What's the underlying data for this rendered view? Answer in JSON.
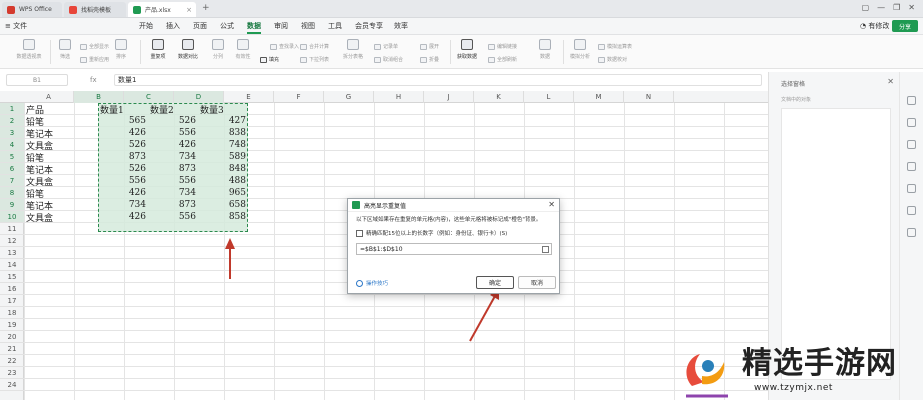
{
  "titlebar": {
    "tabs": [
      {
        "label": "WPS Office",
        "icon": "wps-logo-icon"
      },
      {
        "label": "找稻壳模板",
        "icon": "docer-icon"
      },
      {
        "label": "产品.xlsx",
        "icon": "spreadsheet-icon"
      }
    ],
    "new_tab": "+"
  },
  "menubar": {
    "file_label": "文件",
    "items": [
      "开始",
      "插入",
      "页面",
      "公式",
      "数据",
      "审阅",
      "视图",
      "工具",
      "会员专享",
      "效率"
    ],
    "active": "数据",
    "comment_label": "有修改",
    "share_label": "分享"
  },
  "ribbon": {
    "buttons": [
      {
        "label": "数据透视表",
        "active": false
      },
      {
        "label": "筛选",
        "active": false
      },
      {
        "label": "排序",
        "active": false
      },
      {
        "label": "重复项",
        "active": true
      },
      {
        "label": "数据对比",
        "active": true
      },
      {
        "label": "分列",
        "active": false
      },
      {
        "label": "有效性",
        "active": false
      },
      {
        "label": "合并计算",
        "active": false
      },
      {
        "label": "拆分表格",
        "active": false
      },
      {
        "label": "获取数据",
        "active": true
      },
      {
        "label": "全部刷新",
        "active": false
      },
      {
        "label": "数据",
        "active": false
      },
      {
        "label": "模拟分析",
        "active": false
      }
    ],
    "small": [
      {
        "label": "全部显示",
        "active": false
      },
      {
        "label": "重新应用",
        "active": false
      },
      {
        "label": "填充",
        "active": true
      },
      {
        "label": "查找录入",
        "active": false
      },
      {
        "label": "下拉列表",
        "active": false
      },
      {
        "label": "记录单",
        "active": false
      },
      {
        "label": "创建组",
        "active": false
      },
      {
        "label": "取消组合",
        "active": false
      },
      {
        "label": "展开",
        "active": false
      },
      {
        "label": "折叠",
        "active": false
      },
      {
        "label": "编辑链接",
        "active": false
      },
      {
        "label": "模拟运算表",
        "active": false
      },
      {
        "label": "数据校对",
        "active": false
      }
    ]
  },
  "formula": {
    "name_box": "B1",
    "fx": "fx",
    "value": "数量1"
  },
  "sheet": {
    "columns": [
      "A",
      "B",
      "C",
      "D",
      "E",
      "F",
      "G",
      "H",
      "J",
      "K",
      "L",
      "M",
      "N"
    ],
    "rows": [
      "1",
      "2",
      "3",
      "4",
      "5",
      "6",
      "7",
      "8",
      "9",
      "10",
      "11",
      "12",
      "13",
      "14",
      "15",
      "16",
      "17",
      "18",
      "19",
      "20",
      "21",
      "22",
      "23",
      "24"
    ],
    "header_row": [
      "产品",
      "数量1",
      "数量2",
      "数量3"
    ],
    "data": [
      [
        "铅笔",
        "565",
        "526",
        "427"
      ],
      [
        "笔记本",
        "426",
        "556",
        "838"
      ],
      [
        "文具盒",
        "526",
        "426",
        "748"
      ],
      [
        "铅笔",
        "873",
        "734",
        "589"
      ],
      [
        "笔记本",
        "526",
        "873",
        "848"
      ],
      [
        "文具盒",
        "556",
        "556",
        "488"
      ],
      [
        "铅笔",
        "426",
        "734",
        "965"
      ],
      [
        "笔记本",
        "734",
        "873",
        "658"
      ],
      [
        "文具盒",
        "426",
        "556",
        "858"
      ]
    ]
  },
  "dialog": {
    "title": "高亮显示重复值",
    "description": "以下区域如果存在重复的单元格(内容)，这些单元格将被标记成\"橙色\"背景。",
    "checkbox": "精确匹配15位以上的长数字（例如：身份证、银行卡）(S)",
    "input_value": "=$B$1:$D$10",
    "tips": "操作技巧",
    "ok": "确定",
    "cancel": "取消"
  },
  "side_panel": {
    "title": "选择窗格",
    "subtitle": "文档中的对象"
  },
  "watermark": {
    "title": "精选手游网",
    "url": "www.tzymjx.net"
  },
  "colors": {
    "accent": "#1f9a52",
    "selection": "#d5eadc",
    "arrow": "#c0392b"
  }
}
